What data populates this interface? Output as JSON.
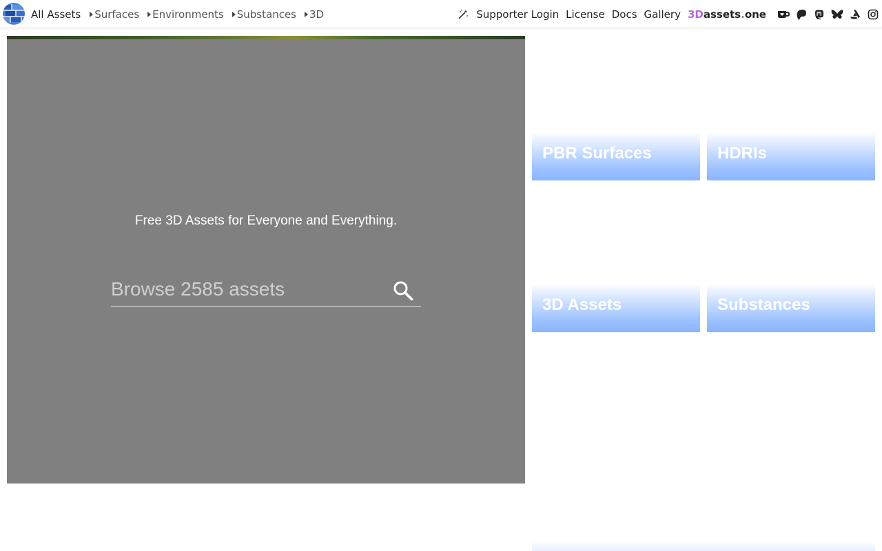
{
  "nav": {
    "all_assets": "All Assets",
    "categories": [
      {
        "label": "Surfaces"
      },
      {
        "label": "Environments"
      },
      {
        "label": "Substances"
      },
      {
        "label": "3D"
      }
    ],
    "supporter_login": "Supporter Login",
    "license": "License",
    "docs": "Docs",
    "gallery": "Gallery",
    "brand": {
      "p1": "3D",
      "p2": "assets",
      "p3": ".",
      "p4": "one"
    },
    "icons": [
      "magic-wand-icon",
      "kofi-icon",
      "patreon-icon",
      "mastodon-icon",
      "bluesky-icon",
      "artstation-icon",
      "instagram-icon"
    ]
  },
  "hero": {
    "tagline": "Free 3D Assets for Everyone and Everything.",
    "search_placeholder": "Browse 2585 assets"
  },
  "tiles": [
    {
      "label": "PBR Surfaces"
    },
    {
      "label": "HDRIs"
    },
    {
      "label": "3D Assets"
    },
    {
      "label": "Substances"
    }
  ],
  "colors": {
    "hero_bg": "#808080",
    "tile_accent": "#8ab5ff",
    "brand_accent": "#b66ad6"
  }
}
